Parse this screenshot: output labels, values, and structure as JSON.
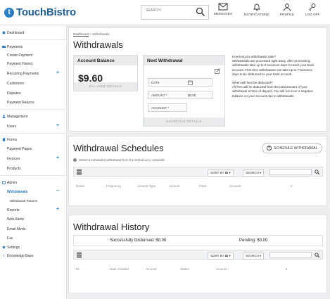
{
  "brand": {
    "name": "TouchBistro",
    "mark": "t"
  },
  "header": {
    "search_placeholder": "SEARCH",
    "nav": [
      {
        "label": "MESSAGES",
        "icon": "envelope-icon"
      },
      {
        "label": "NOTIFICATIONS",
        "icon": "bell-icon"
      },
      {
        "label": "PROFILE",
        "icon": "user-icon"
      },
      {
        "label": "LOG OFF",
        "icon": "key-icon"
      }
    ]
  },
  "sidebar": {
    "items": [
      {
        "label": "Dashboard"
      },
      {
        "label": "Payments"
      },
      {
        "label": "Create Payment"
      },
      {
        "label": "Payment History"
      },
      {
        "label": "Recurring Payments",
        "plus": "+"
      },
      {
        "label": "Customers"
      },
      {
        "label": "Disputes"
      },
      {
        "label": "Payment Returns"
      },
      {
        "label": "Management"
      },
      {
        "label": "Users",
        "plus": "+"
      },
      {
        "label": "Forms"
      },
      {
        "label": "Payment Pages"
      },
      {
        "label": "Invoices",
        "plus": "+"
      },
      {
        "label": "Products"
      },
      {
        "label": "Admin"
      },
      {
        "label": "Withdrawals",
        "plus": "−"
      },
      {
        "label": "Withdrawal Returns"
      },
      {
        "label": "Reports",
        "plus": "+"
      },
      {
        "label": "Web Alerts"
      },
      {
        "label": "Email Alerts"
      },
      {
        "label": "Fax"
      },
      {
        "label": "Settings"
      },
      {
        "label": "Knowledge Base"
      }
    ]
  },
  "breadcrumb": {
    "link": "Dashboard",
    "sep": " > ",
    "current": "Withdrawals"
  },
  "page_title": "Withdrawals",
  "balance": {
    "title": "Account Balance",
    "amount": "$9.60",
    "details": "BALANCE DETAILS"
  },
  "withdrawal": {
    "title": "Next Withdrawal",
    "date_label": "DATE",
    "amount_label": "AMOUNT *",
    "amount_value": "$0.00",
    "account_label": "ACCOUNT *",
    "details": "SCHEDULE DETAILS"
  },
  "info": {
    "q1": "How long do withdrawals take?",
    "a1": "Withdrawals are processed right away, after processing, withdrawals take up to 5 business days to reach your bank account. First-time withdrawals can take up to 7 business days to be disbursed to your bank account.",
    "q2": "When will fees be deducted?",
    "a2": "All fees will be deducted from the total amount of your withdrawal at time of deposit. You will not incur a negative balance on your account due to withdrawals."
  },
  "schedules": {
    "title": "Withdrawal Schedules",
    "button": "SCHEDULE WITHDRAWAL",
    "hint": "Select a scheduled withdrawal from the list below to view/edit",
    "sort": "SORT BY",
    "sort_field": "ID",
    "search": "SEARCH",
    "columns": [
      "Name",
      "Frequency",
      "Amount Type",
      "Amount",
      "Float",
      "Account"
    ]
  },
  "history": {
    "title": "Withdrawal History",
    "disbursed": "Successfully Disbursed: $0.00",
    "pending": "Pending: $0.00",
    "sort": "SORT BY",
    "sort_field": "ID",
    "search": "SEARCH",
    "columns": [
      "ID",
      "Date Created",
      "Amount",
      "Status",
      "Amount"
    ]
  },
  "colors": {
    "brand": "#1e5f95",
    "accent": "#2a7fc4",
    "panel": "#e9ebed",
    "page_bg": "#eceef0"
  }
}
